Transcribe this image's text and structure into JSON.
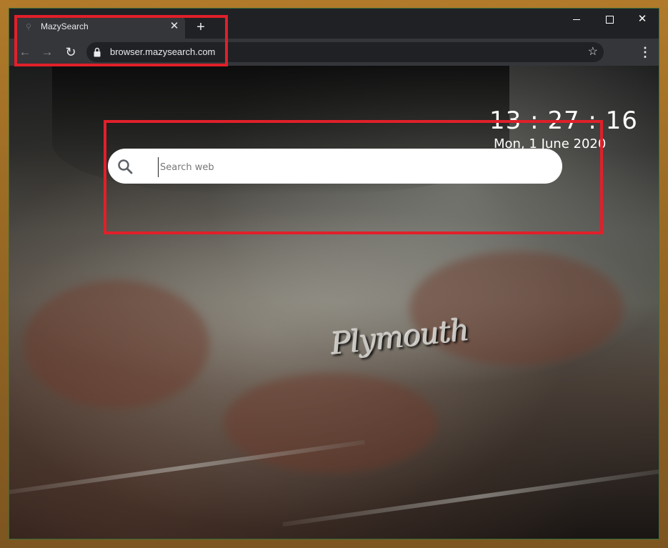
{
  "browser": {
    "tab_title": "MazySearch",
    "tab_close_icon": "close-icon",
    "new_tab_symbol": "+",
    "url": "browser.mazysearch.com",
    "window_controls": [
      "minimize",
      "maximize",
      "close"
    ],
    "bookmark_icon": "star-icon",
    "menu_icon": "kebab-menu-icon"
  },
  "page": {
    "clock": "13 : 27 : 16",
    "date": "Mon, 1 June 2020",
    "search": {
      "placeholder": "Search web",
      "value": ""
    },
    "emblem_text": "Plymouth"
  },
  "colors": {
    "annotation_red": "#e0202a",
    "chrome_dark": "#202124",
    "chrome_toolbar": "#35363a"
  }
}
